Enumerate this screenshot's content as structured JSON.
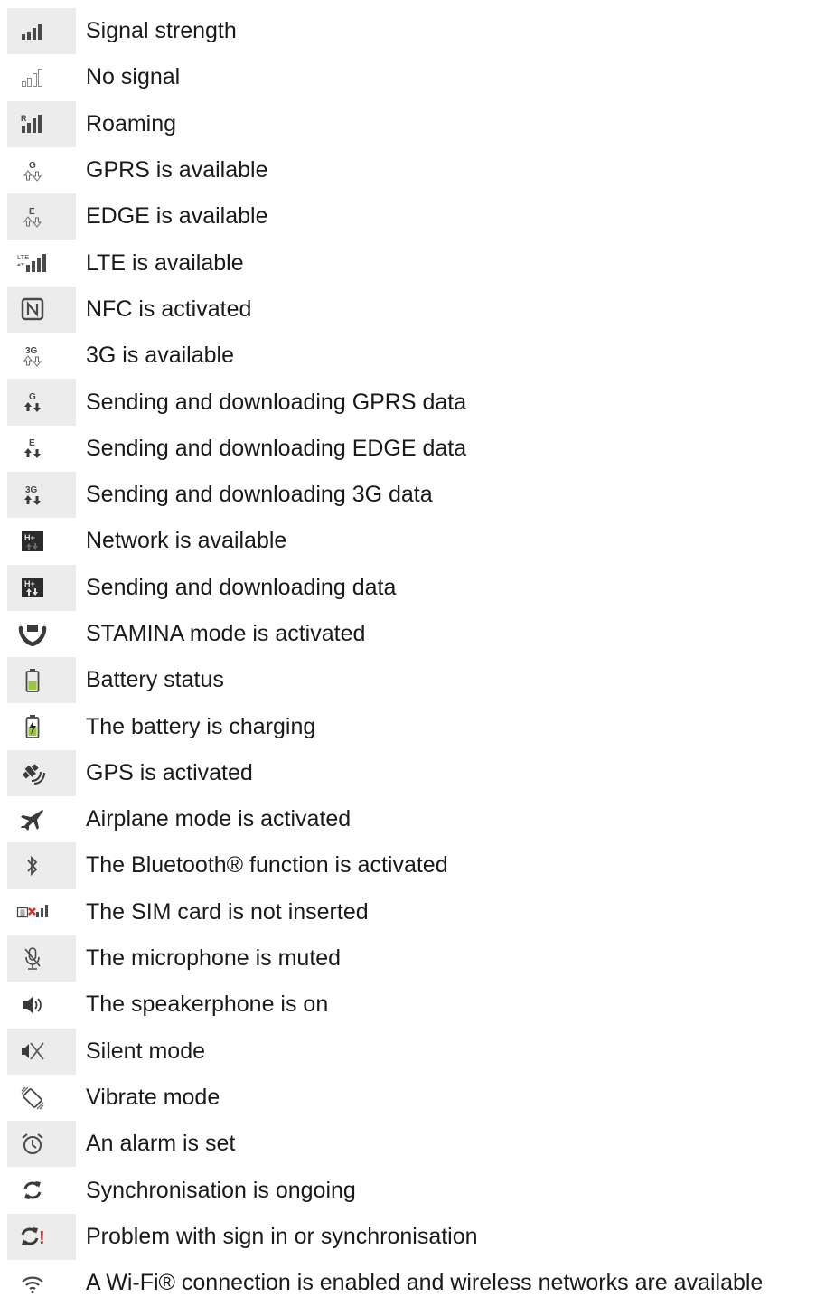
{
  "rows": [
    {
      "icon": "signal-strength-icon",
      "label": "Signal strength"
    },
    {
      "icon": "no-signal-icon",
      "label": "No signal"
    },
    {
      "icon": "roaming-icon",
      "label": "Roaming"
    },
    {
      "icon": "gprs-icon",
      "label": "GPRS is available"
    },
    {
      "icon": "edge-icon",
      "label": "EDGE is available"
    },
    {
      "icon": "lte-icon",
      "label": "LTE is available"
    },
    {
      "icon": "nfc-icon",
      "label": "NFC is activated"
    },
    {
      "icon": "3g-icon",
      "label": "3G is available"
    },
    {
      "icon": "gprs-data-icon",
      "label": "Sending and downloading GPRS data"
    },
    {
      "icon": "edge-data-icon",
      "label": "Sending and downloading EDGE data"
    },
    {
      "icon": "3g-data-icon",
      "label": "Sending and downloading 3G data"
    },
    {
      "icon": "network-available-icon",
      "label": "Network is available"
    },
    {
      "icon": "network-data-icon",
      "label": "Sending and downloading data"
    },
    {
      "icon": "stamina-icon",
      "label": "STAMINA mode is activated"
    },
    {
      "icon": "battery-icon",
      "label": "Battery status"
    },
    {
      "icon": "battery-charging-icon",
      "label": "The battery is charging"
    },
    {
      "icon": "gps-icon",
      "label": "GPS is activated"
    },
    {
      "icon": "airplane-icon",
      "label": "Airplane mode is activated"
    },
    {
      "icon": "bluetooth-icon",
      "label": "The Bluetooth® function is activated"
    },
    {
      "icon": "no-sim-icon",
      "label": "The SIM card is not inserted"
    },
    {
      "icon": "mic-muted-icon",
      "label": "The microphone is muted"
    },
    {
      "icon": "speakerphone-icon",
      "label": "The speakerphone is on"
    },
    {
      "icon": "silent-mode-icon",
      "label": "Silent mode"
    },
    {
      "icon": "vibrate-icon",
      "label": "Vibrate mode"
    },
    {
      "icon": "alarm-icon",
      "label": "An alarm is set"
    },
    {
      "icon": "sync-icon",
      "label": "Synchronisation is ongoing"
    },
    {
      "icon": "sync-problem-icon",
      "label": "Problem with sign in or synchronisation"
    },
    {
      "icon": "wifi-icon",
      "label": "A Wi-Fi® connection is enabled and wireless networks are available"
    }
  ],
  "icon_letters": {
    "roaming": "R",
    "gprs": "G",
    "edge": "E",
    "lte": "LTE",
    "three_g": "3G",
    "hplus": "H+",
    "sync_problem": "!"
  },
  "colors": {
    "icon_dark": "#4a4a4a",
    "icon_light": "#9a9a9a",
    "battery_green": "#9bc53d",
    "sim_red": "#d22b2b",
    "error_red": "#d22b2b",
    "shade": "#ececec"
  }
}
